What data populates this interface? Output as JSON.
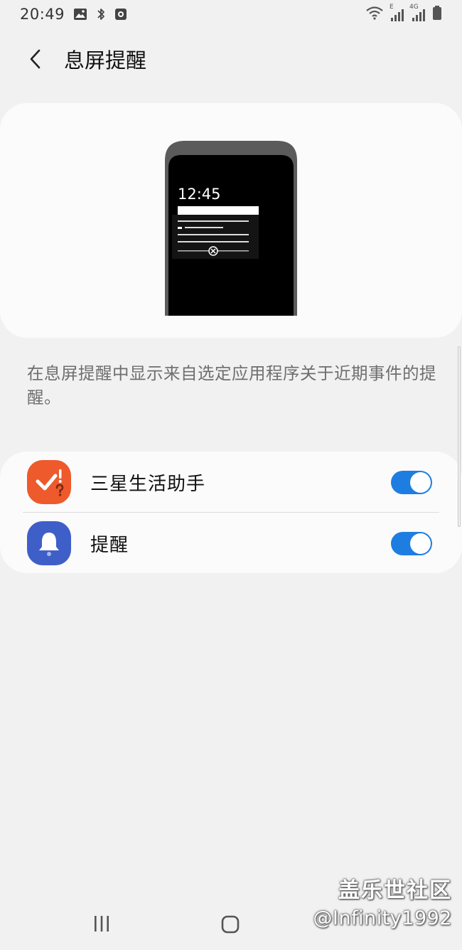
{
  "status_bar": {
    "time": "20:49",
    "network_label_e": "E",
    "network_label_4g": "4G",
    "icons": [
      "image-icon",
      "bluetooth-icon",
      "screen-record-icon",
      "wifi-icon",
      "signal-icon",
      "battery-icon"
    ]
  },
  "header": {
    "back_icon": "chevron-left-icon",
    "title": "息屏提醒"
  },
  "preview": {
    "time": "12:45"
  },
  "description": "在息屏提醒中显示来自选定应用程序关于近期事件的提醒。",
  "apps": [
    {
      "label": "三星生活助手",
      "icon": "reminder-check-icon",
      "icon_color": "#ee5a2c",
      "enabled": true
    },
    {
      "label": "提醒",
      "icon": "bell-icon",
      "icon_color": "#3f5fc8",
      "enabled": true
    }
  ],
  "colors": {
    "toggle_on": "#1e7de0",
    "background": "#f1f1f1",
    "card": "#fbfbfb"
  },
  "watermark": {
    "line1": "盖乐世社区",
    "line2": "@Infinity1992"
  }
}
